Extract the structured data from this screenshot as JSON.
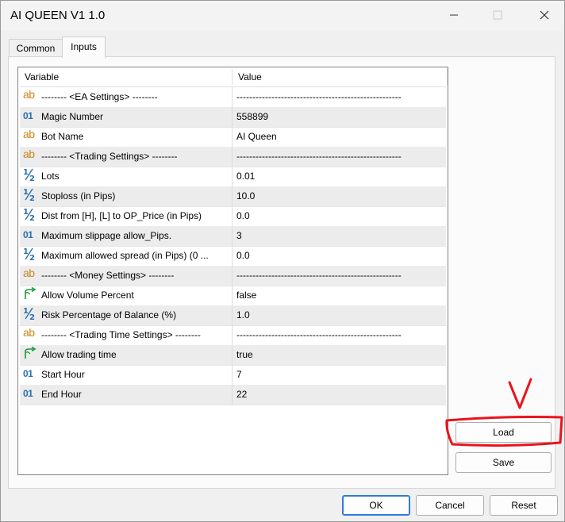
{
  "window": {
    "title": "AI QUEEN V1 1.0"
  },
  "tabs": [
    {
      "label": "Common"
    },
    {
      "label": "Inputs"
    }
  ],
  "grid": {
    "columns": {
      "variable": "Variable",
      "value": "Value"
    },
    "rows": [
      {
        "icon": "ab",
        "variable": "-------- <EA Settings> --------",
        "value": "----------------------------------------------------"
      },
      {
        "icon": "01",
        "variable": "Magic Number",
        "value": "558899"
      },
      {
        "icon": "ab",
        "variable": "Bot Name",
        "value": "AI Queen"
      },
      {
        "icon": "ab",
        "variable": "-------- <Trading Settings> --------",
        "value": "----------------------------------------------------"
      },
      {
        "icon": "half",
        "variable": "Lots",
        "value": "0.01"
      },
      {
        "icon": "half",
        "variable": "Stoploss (in Pips)",
        "value": "10.0"
      },
      {
        "icon": "half",
        "variable": "Dist from [H], [L] to OP_Price (in Pips)",
        "value": "0.0"
      },
      {
        "icon": "01",
        "variable": "Maximum slippage allow_Pips.",
        "value": "3"
      },
      {
        "icon": "half",
        "variable": "Maximum allowed spread (in Pips) (0 ...",
        "value": "0.0"
      },
      {
        "icon": "ab",
        "variable": "-------- <Money Settings> --------",
        "value": "----------------------------------------------------"
      },
      {
        "icon": "bool",
        "variable": "Allow Volume Percent",
        "value": "false"
      },
      {
        "icon": "half",
        "variable": "Risk Percentage of Balance (%)",
        "value": "1.0"
      },
      {
        "icon": "ab",
        "variable": "-------- <Trading Time Settings> --------",
        "value": "----------------------------------------------------"
      },
      {
        "icon": "bool",
        "variable": "Allow trading time",
        "value": "true"
      },
      {
        "icon": "01",
        "variable": "Start Hour",
        "value": "7"
      },
      {
        "icon": "01",
        "variable": "End Hour",
        "value": "22"
      }
    ]
  },
  "icon_text": {
    "ab": "ab",
    "01": "01"
  },
  "side_buttons": {
    "load": "Load",
    "save": "Save"
  },
  "footer_buttons": {
    "ok": "OK",
    "cancel": "Cancel",
    "reset": "Reset"
  },
  "colors": {
    "annotation": "#e8141c",
    "ab_icon": "#c9871c",
    "int_icon": "#2a6fb0",
    "bool_icon": "#1a9a3a"
  }
}
